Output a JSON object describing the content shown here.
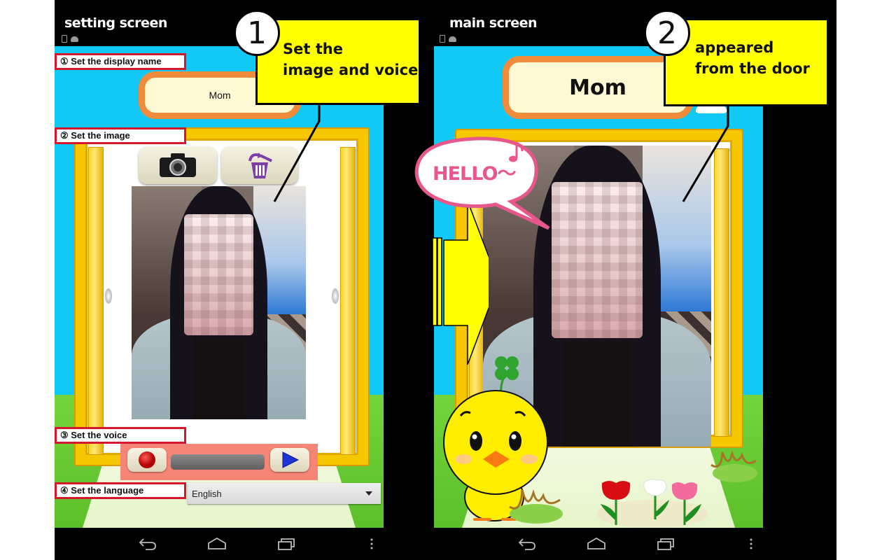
{
  "colors": {
    "sky": "#12c8f5",
    "callout_bg": "#ffff00",
    "label_border": "#d3182e",
    "name_box_border": "#f08b3c",
    "name_box_fill": "#fff9d4",
    "door_gold": "#f5c700",
    "voice_bar_bg": "#f58576",
    "bubble_pink": "#e8578c"
  },
  "setting_screen": {
    "title": "setting screen",
    "status_icons": [
      "sd-card-icon",
      "android-icon"
    ],
    "labels": {
      "display_name": "① Set the display name",
      "image": "② Set the image",
      "voice": "③ Set the voice",
      "language": "④ Set the language"
    },
    "display_name_value": "Mom",
    "image_buttons": [
      {
        "name": "camera",
        "icon": "camera-icon"
      },
      {
        "name": "delete",
        "icon": "trash-icon"
      }
    ],
    "voice_controls": {
      "record_icon": "record-icon",
      "play_icon": "play-icon"
    },
    "language_select": {
      "value": "English"
    },
    "photo_alt": "Pixelated portrait photo"
  },
  "main_screen": {
    "title": "main screen",
    "status_icons": [
      "sd-card-icon",
      "android-icon"
    ],
    "display_name": "Mom",
    "speech_bubble": "HELLO～",
    "photo_alt": "Pixelated portrait photo appearing in doorway"
  },
  "callouts": [
    {
      "number": "1",
      "text_line1": "Set the",
      "text_line2": "image and voice"
    },
    {
      "number": "2",
      "text_line1": "appeared",
      "text_line2": "from the door"
    }
  ],
  "nav_bar": {
    "buttons": [
      "back-icon",
      "home-icon",
      "recent-apps-icon",
      "menu-icon"
    ]
  }
}
